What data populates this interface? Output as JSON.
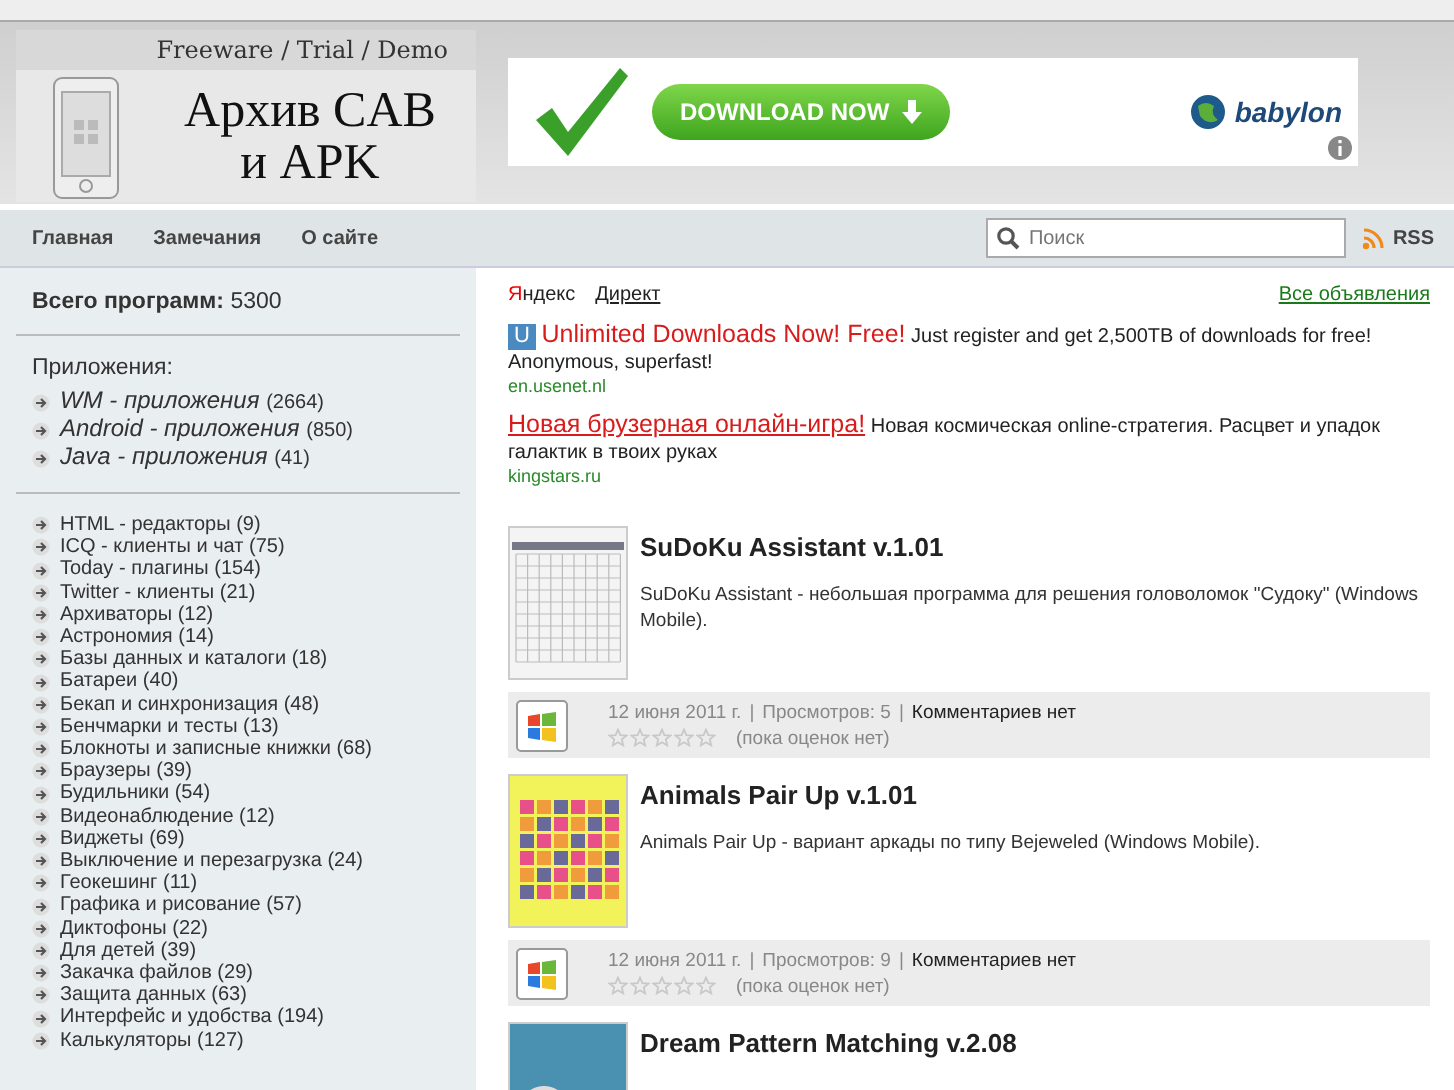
{
  "header": {
    "tagline": "Freeware / Trial / Demo",
    "site_title": "Архив CAB и APK",
    "banner": {
      "button": "DOWNLOAD NOW",
      "brand": "babylon"
    }
  },
  "nav": {
    "items": [
      "Главная",
      "Замечания",
      "О сайте"
    ],
    "search": {
      "placeholder": "Поиск"
    },
    "rss": "RSS"
  },
  "sidebar": {
    "total_label": "Всего программ:",
    "total": "5300",
    "apps_heading": "Приложения:",
    "platforms": [
      {
        "name": "WM - приложения",
        "count": "(2664)"
      },
      {
        "name": "Android - приложения",
        "count": "(850)"
      },
      {
        "name": "Java - приложения",
        "count": "(41)"
      }
    ],
    "categories": [
      {
        "name": "HTML - редакторы",
        "count": "(9)"
      },
      {
        "name": "ICQ - клиенты и чат",
        "count": "(75)"
      },
      {
        "name": "Today - плагины",
        "count": "(154)"
      },
      {
        "name": "Twitter - клиенты",
        "count": "(21)"
      },
      {
        "name": "Архиваторы",
        "count": "(12)"
      },
      {
        "name": "Астрономия",
        "count": "(14)"
      },
      {
        "name": "Базы данных и каталоги",
        "count": "(18)"
      },
      {
        "name": "Батареи",
        "count": "(40)"
      },
      {
        "name": "Бекап и синхронизация",
        "count": "(48)"
      },
      {
        "name": "Бенчмарки и тесты",
        "count": "(13)"
      },
      {
        "name": "Блокноты и записные книжки",
        "count": "(68)"
      },
      {
        "name": "Браузеры",
        "count": "(39)"
      },
      {
        "name": "Будильники",
        "count": "(54)"
      },
      {
        "name": "Видеонаблюдение",
        "count": "(12)"
      },
      {
        "name": "Виджеты",
        "count": "(69)"
      },
      {
        "name": "Выключение и перезагрузка",
        "count": "(24)"
      },
      {
        "name": "Геокешинг",
        "count": "(11)"
      },
      {
        "name": "Графика и рисование",
        "count": "(57)"
      },
      {
        "name": "Диктофоны",
        "count": "(22)"
      },
      {
        "name": "Для детей",
        "count": "(39)"
      },
      {
        "name": "Закачка файлов",
        "count": "(29)"
      },
      {
        "name": "Защита данных",
        "count": "(63)"
      },
      {
        "name": "Интерфейс и удобства",
        "count": "(194)"
      },
      {
        "name": "Калькуляторы",
        "count": "(127)"
      }
    ]
  },
  "ads": {
    "brand_first": "Я",
    "brand_rest": "ндекс",
    "direct": "Директ",
    "all_ads": "Все объявления",
    "items": [
      {
        "badge": "U",
        "title": "Unlimited Downloads Now! Free!",
        "text": "Just register and get 2,500TB of downloads for free! Anonymous, superfast!",
        "domain": "en.usenet.nl"
      },
      {
        "title": "Новая брузерная онлайн-игра!",
        "text": "Новая космическая online-стратегия. Расцвет и упадок галактик в твоих руках",
        "domain": "kingstars.ru"
      }
    ]
  },
  "posts_separator": "|",
  "posts": [
    {
      "kind": "sudoku",
      "title": "SuDoKu Assistant v.1.01",
      "description": "SuDoKu Assistant - небольшая программа для решения головоломок \"Судоку\" (Windows Mobile).",
      "date": "12 июня 2011 г.",
      "views": "Просмотров: 5",
      "comments": "Комментариев нет",
      "stars": 0,
      "rating": "(пока оценок нет)"
    },
    {
      "kind": "animals",
      "title": "Animals Pair Up v.1.01",
      "description": "Animals Pair Up - вариант аркады по типу Bejeweled (Windows Mobile).",
      "date": "12 июня 2011 г.",
      "views": "Просмотров: 9",
      "comments": "Комментариев нет",
      "stars": 0,
      "rating": "(пока оценок нет)"
    },
    {
      "kind": "dream",
      "title": "Dream Pattern Matching v.2.08"
    }
  ]
}
